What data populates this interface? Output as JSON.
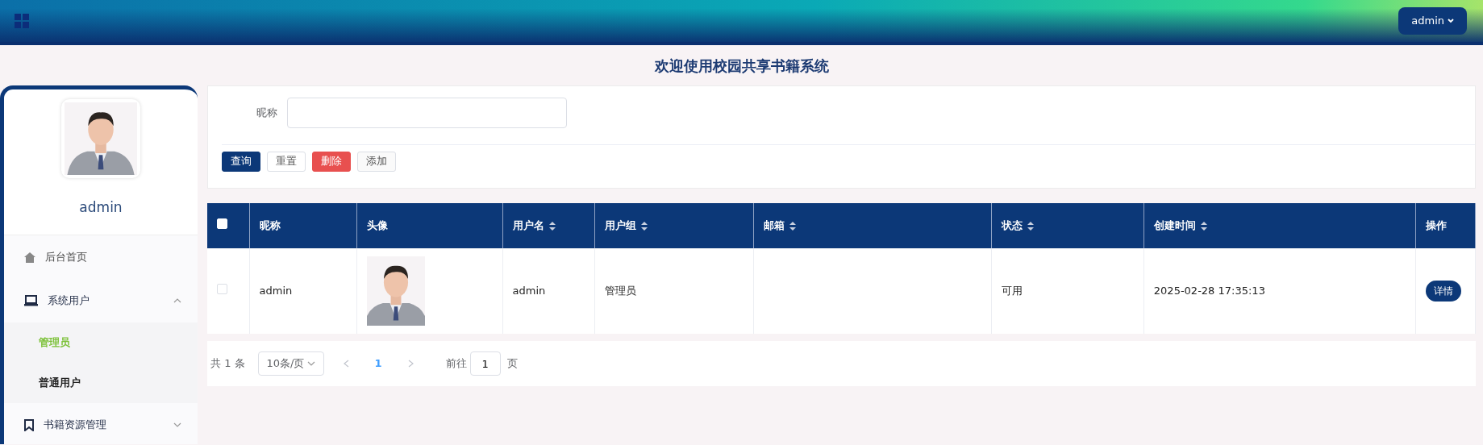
{
  "header": {
    "user_menu": "admin"
  },
  "title": "欢迎使用校园共享书籍系统",
  "sidebar": {
    "avatar": {
      "kind": "picture"
    },
    "username": "admin",
    "menu": [
      {
        "label": "后台首页",
        "kind": "link"
      },
      {
        "label": "系统用户",
        "kind": "group",
        "expanded": true,
        "children": [
          {
            "label": "管理员",
            "selected": true
          },
          {
            "label": "普通用户",
            "selected": false
          }
        ]
      },
      {
        "label": "书籍资源管理",
        "kind": "group",
        "expanded": false
      }
    ]
  },
  "search": {
    "fields": [
      {
        "label": "昵称"
      }
    ],
    "buttons": [
      {
        "label": "查询",
        "kind": "primary"
      },
      {
        "label": "重置",
        "kind": "plain"
      },
      {
        "label": "删除",
        "kind": "danger"
      },
      {
        "label": "添加",
        "kind": "light"
      }
    ]
  },
  "table": {
    "select_all": {
      "checked": false
    },
    "columns": [
      {
        "label": "昵称",
        "sortable": false
      },
      {
        "label": "头像",
        "sortable": false
      },
      {
        "label": "用户名",
        "sortable": true
      },
      {
        "label": "用户组",
        "sortable": true
      },
      {
        "label": "邮箱",
        "sortable": true
      },
      {
        "label": "状态",
        "sortable": true
      },
      {
        "label": "创建时间",
        "sortable": true
      },
      {
        "label": "操作",
        "sortable": false
      }
    ],
    "rows": [
      {
        "checked": false,
        "cells": [
          {
            "kind": "text",
            "text": "admin"
          },
          {
            "kind": "picture"
          },
          {
            "kind": "text",
            "text": "admin"
          },
          {
            "kind": "text",
            "text": "管理员"
          },
          {
            "kind": "empty"
          },
          {
            "kind": "text",
            "text": "可用"
          },
          {
            "kind": "text",
            "text": "2025-02-28 17:35:13"
          },
          {
            "kind": "button",
            "text": "详情"
          }
        ]
      }
    ]
  },
  "pagination": {
    "total": "共 1 条",
    "page_size": "10条/页",
    "pages": [
      {
        "label": "1",
        "selected": true
      }
    ],
    "goto_label": "前往",
    "goto_value": "1",
    "goto_suffix": "页"
  }
}
